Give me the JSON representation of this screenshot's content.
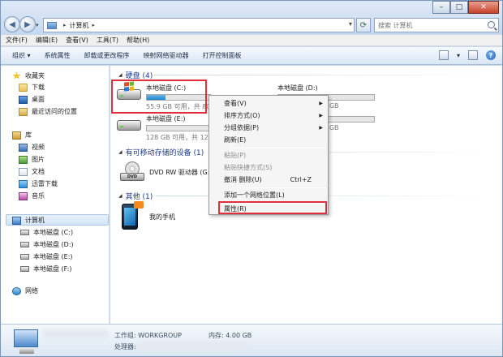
{
  "window": {
    "address": {
      "path_item": "计算机"
    },
    "search": {
      "placeholder": "搜索 计算机"
    },
    "controls": {
      "minimize": "–",
      "maximize": "□",
      "close": "✕"
    }
  },
  "menubar": [
    "文件(F)",
    "编辑(E)",
    "查看(V)",
    "工具(T)",
    "帮助(H)"
  ],
  "toolbar": {
    "organize": "组织 ▾",
    "items": [
      "系统属性",
      "卸载或更改程序",
      "映射网络驱动器",
      "打开控制面板"
    ]
  },
  "sidebar": {
    "favorites": {
      "title": "收藏夹",
      "items": [
        "下载",
        "桌面",
        "最近访问的位置"
      ]
    },
    "library": {
      "title": "库",
      "items": [
        "视频",
        "图片",
        "文档",
        "迅雷下载",
        "音乐"
      ]
    },
    "computer": {
      "title": "计算机",
      "items": [
        "本地磁盘 (C:)",
        "本地磁盘 (D:)",
        "本地磁盘 (E:)",
        "本地磁盘 (F:)"
      ]
    },
    "network": {
      "title": "网络"
    }
  },
  "groups": {
    "hdd": "硬盘 (4)",
    "removable": "有可移动存储的设备 (1)",
    "other": "其他 (1)"
  },
  "drives": [
    {
      "name": "本地磁盘 (C:)",
      "info": "55.9 GB 可用，共 80",
      "used_fraction": 0.3
    },
    {
      "name": "本地磁盘 (D:)",
      "info": "129 GB",
      "used_fraction": 0.0
    },
    {
      "name": "本地磁盘 (E:)",
      "info": "128 GB 可用，共 129",
      "used_fraction": 0.0
    },
    {
      "name": "",
      "info": "129 GB",
      "used_fraction": 0.0
    }
  ],
  "dvd": {
    "name": "DVD RW 驱动器 (G:)"
  },
  "phone": {
    "name": "我的手机"
  },
  "context_menu": {
    "items": [
      {
        "label": "查看(V)",
        "submenu": true,
        "disabled": false
      },
      {
        "label": "排序方式(O)",
        "submenu": true,
        "disabled": false
      },
      {
        "label": "分组依据(P)",
        "submenu": true,
        "disabled": false
      },
      {
        "label": "刷新(E)",
        "submenu": false,
        "disabled": false
      },
      {
        "label": "粘贴(P)",
        "submenu": false,
        "disabled": true
      },
      {
        "label": "粘贴快捷方式(S)",
        "submenu": false,
        "disabled": true
      },
      {
        "label": "撤消 删除(U)",
        "shortcut": "Ctrl+Z",
        "submenu": false,
        "disabled": false
      },
      {
        "label": "添加一个网络位置(L)",
        "submenu": false,
        "disabled": false
      },
      {
        "label": "属性(R)",
        "submenu": false,
        "disabled": false
      }
    ]
  },
  "details": {
    "workgroup": "工作组: WORKGROUP",
    "memory": "内存: 4.00 GB",
    "processor": "处理器:"
  },
  "colors": {
    "highlight": "#e0303c",
    "link_blue": "#1e3a8a"
  }
}
